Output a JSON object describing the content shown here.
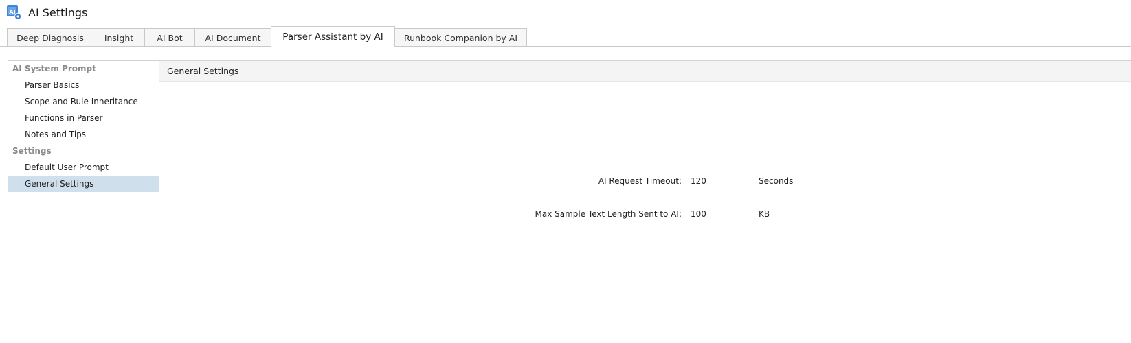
{
  "app": {
    "title": "AI Settings",
    "icon": "ai-settings-icon"
  },
  "tabs": [
    {
      "label": "Deep Diagnosis",
      "active": false
    },
    {
      "label": "Insight",
      "active": false
    },
    {
      "label": "AI Bot",
      "active": false
    },
    {
      "label": "AI Document",
      "active": false
    },
    {
      "label": "Parser Assistant by AI",
      "active": true
    },
    {
      "label": "Runbook Companion by AI",
      "active": false
    }
  ],
  "sidebar": {
    "groups": [
      {
        "title": "AI System Prompt",
        "items": [
          {
            "label": "Parser Basics"
          },
          {
            "label": "Scope and Rule Inheritance"
          },
          {
            "label": "Functions in Parser"
          },
          {
            "label": "Notes and Tips"
          }
        ]
      },
      {
        "title": "Settings",
        "items": [
          {
            "label": "Default User Prompt"
          },
          {
            "label": "General Settings",
            "selected": true
          }
        ]
      }
    ]
  },
  "main": {
    "header": "General Settings",
    "fields": [
      {
        "label": "AI Request Timeout:",
        "value": "120",
        "unit": "Seconds"
      },
      {
        "label": "Max Sample Text Length Sent to AI:",
        "value": "100",
        "unit": "KB"
      }
    ]
  },
  "colors": {
    "selected_bg": "#cfe0ec",
    "group_header": "#8a8a8a",
    "icon_blue": "#2f7cd3"
  }
}
